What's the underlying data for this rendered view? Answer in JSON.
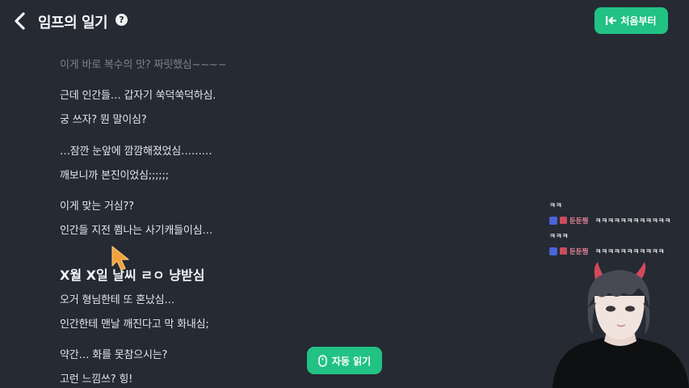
{
  "header": {
    "title": "임프의 일기",
    "help_glyph": "?",
    "restart_label": "처음부터"
  },
  "story": {
    "lines": [
      "이게 바로 복수의 맛? 짜릿했심~~~~",
      "근데 인간들… 갑자기 쑥덕쑥덕하심.",
      "궁 쓰자? 뭔 말이심?",
      "…잠깐 눈앞에 깜깜해졌었심………",
      "깨보니까 본진이었심;;;;;;",
      "이게 맞는 거심??",
      "인간들 지전 쬠나는 사기캐들이심…",
      "X월 X일 날씨 ㄹㅇ 냥받심",
      "오거 형님한테 또 혼났심…",
      "인간한테 맨날 깨진다고 막 화내심;",
      "약간… 화를 못참으시는?",
      "고런 느낌쓰? 힝!"
    ]
  },
  "auto_read": {
    "label": "자동 읽기"
  },
  "chat": {
    "messages": [
      {
        "name": "",
        "text": "ㅋㅋ"
      },
      {
        "name": "둔둔찡",
        "text": "ㅋㅋㅋㅋㅋㅋㅋㅋㅋㅋㅋㅋ"
      },
      {
        "name": "",
        "text": "ㅋㅋㅋ"
      },
      {
        "name": "둔둔찡",
        "text": "ㅋㅋㅋㅋㅋㅋㅋㅋㅋㅋㅋ"
      }
    ]
  },
  "colors": {
    "background": "#252a33",
    "accent": "#21c283",
    "chat_name": "#e8869a"
  },
  "icons": [
    "chevron-left-icon",
    "help-icon",
    "restart-icon",
    "mouse-icon",
    "pointer-cursor-icon",
    "pencil-badge-icon",
    "cake-badge-icon"
  ]
}
